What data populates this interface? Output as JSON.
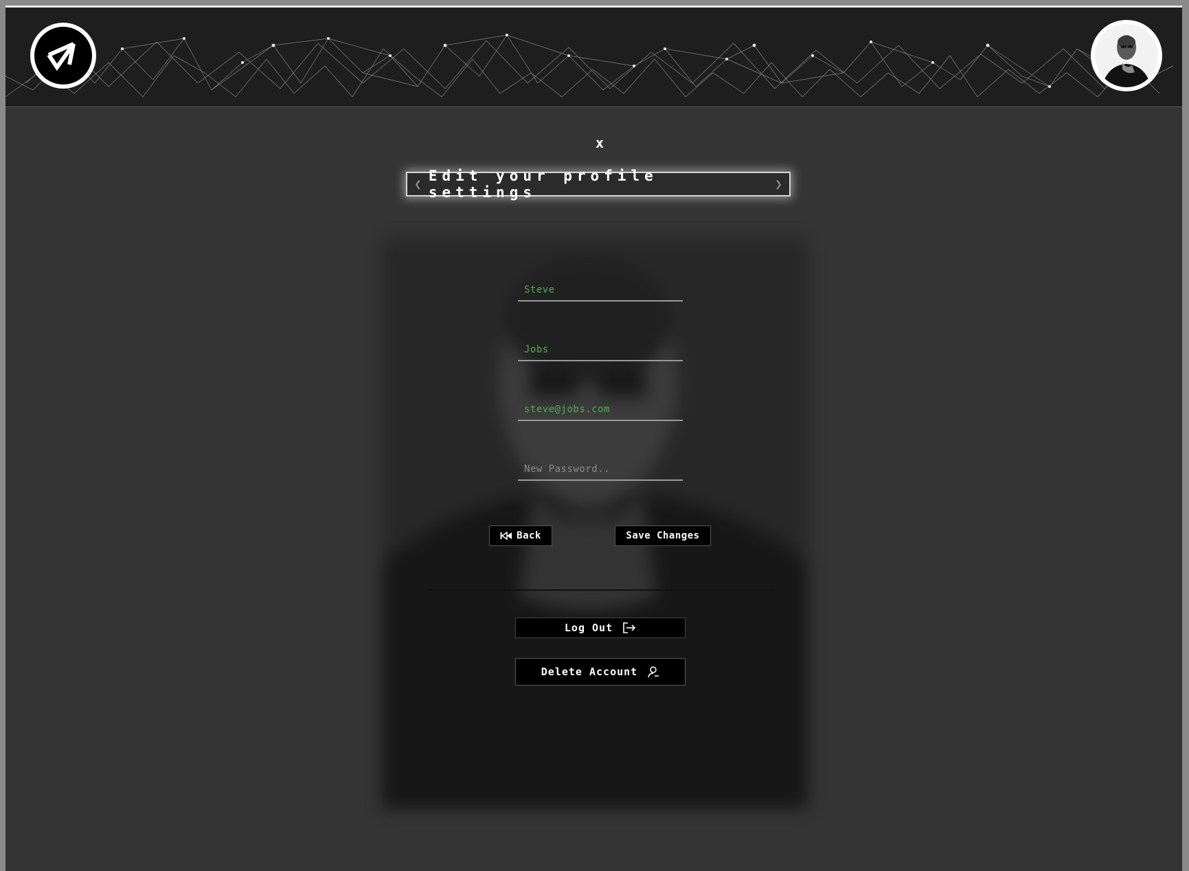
{
  "header": {
    "logo_icon": "triangle-logo-icon",
    "avatar_icon": "user-portrait-avatar",
    "background": "network-mesh-graphic"
  },
  "modal": {
    "close_label": "x",
    "title": "Edit your profile settings",
    "title_left_chevron": "❮",
    "title_right_chevron": "❯"
  },
  "form": {
    "first_name": {
      "value": "Steve",
      "placeholder": ""
    },
    "last_name": {
      "value": "Jobs",
      "placeholder": ""
    },
    "email": {
      "value": "steve@jobs.com",
      "placeholder": ""
    },
    "password": {
      "value": "",
      "placeholder": "New Password.."
    }
  },
  "actions": {
    "back_label": "Back",
    "back_icon": "rewind-icon",
    "save_label": "Save Changes",
    "logout_label": "Log Out",
    "logout_icon": "logout-icon",
    "delete_label": "Delete Account",
    "delete_icon": "user-icon"
  },
  "colors": {
    "background": "#343434",
    "header": "#1e1e1e",
    "input_text": "#4caf50",
    "button": "#000000"
  }
}
